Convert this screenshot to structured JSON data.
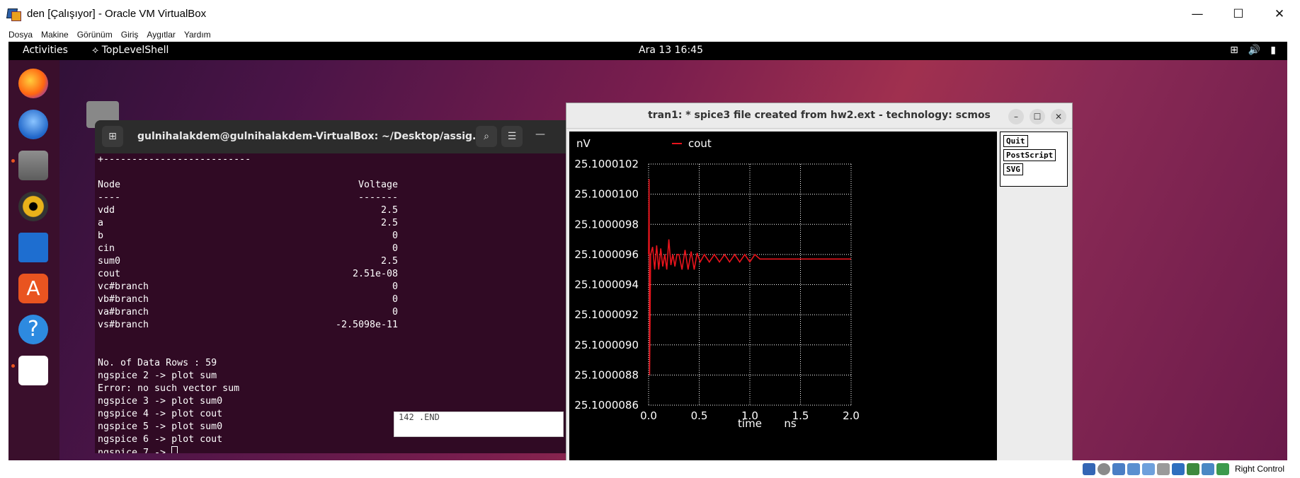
{
  "window": {
    "title": "den [Çalışıyor] - Oracle VM VirtualBox",
    "minimize_glyph": "—",
    "maximize_glyph": "☐",
    "close_glyph": "✕"
  },
  "menubar": {
    "items": [
      "Dosya",
      "Makine",
      "Görünüm",
      "Giriş",
      "Aygıtlar",
      "Yardım"
    ]
  },
  "topbar": {
    "activities": "Activities",
    "app_name": "TopLevelShell",
    "clock": "Ara 13  16:45"
  },
  "terminal": {
    "title": "gulnihalakdem@gulnihalakdem-VirtualBox: ~/Desktop/assig...",
    "lines": [
      {
        "left": "+--------------------------",
        "right": ""
      },
      {
        "left": "",
        "right": ""
      },
      {
        "left": "Node",
        "right": "Voltage"
      },
      {
        "left": "----",
        "right": "-------"
      },
      {
        "left": "vdd",
        "right": "2.5"
      },
      {
        "left": "a",
        "right": "2.5"
      },
      {
        "left": "b",
        "right": "0"
      },
      {
        "left": "cin",
        "right": "0"
      },
      {
        "left": "sum0",
        "right": "2.5"
      },
      {
        "left": "cout",
        "right": "2.51e-08"
      },
      {
        "left": "vc#branch",
        "right": "0"
      },
      {
        "left": "vb#branch",
        "right": "0"
      },
      {
        "left": "va#branch",
        "right": "0"
      },
      {
        "left": "vs#branch",
        "right": "-2.5098e-11"
      },
      {
        "left": "",
        "right": ""
      },
      {
        "left": "",
        "right": ""
      },
      {
        "left": "No. of Data Rows : 59",
        "right": ""
      },
      {
        "left": "ngspice 2 -> plot sum",
        "right": ""
      },
      {
        "left": "Error: no such vector sum",
        "right": ""
      },
      {
        "left": "ngspice 3 -> plot sum0",
        "right": ""
      },
      {
        "left": "ngspice 4 -> plot cout",
        "right": ""
      },
      {
        "left": "ngspice 5 -> plot sum0",
        "right": ""
      },
      {
        "left": "ngspice 6 -> plot cout",
        "right": ""
      }
    ],
    "prompt": "ngspice 7 -> "
  },
  "editor_strip": {
    "text": "142 .END"
  },
  "plot_window": {
    "title": "tran1: * spice3 file created from hw2.ext - technology: scmos",
    "buttons": {
      "quit": "Quit",
      "postscript": "PostScript",
      "svg": "SVG"
    }
  },
  "chart_data": {
    "type": "line",
    "title": "",
    "xlabel": "time",
    "xunit": "ns",
    "ylabel": "",
    "yunit": "nV",
    "xlim": [
      0.0,
      2.0
    ],
    "ylim": [
      25.1000086,
      25.1000102
    ],
    "xticks": [
      "0.0",
      "0.5",
      "1.0",
      "1.5",
      "2.0"
    ],
    "yticks": [
      "25.1000086",
      "25.1000088",
      "25.1000090",
      "25.1000092",
      "25.1000094",
      "25.1000096",
      "25.1000098",
      "25.1000100",
      "25.1000102"
    ],
    "grid": true,
    "legend_position": "top",
    "series": [
      {
        "name": "cout",
        "color": "#e8141c",
        "x": [
          0.0,
          0.005,
          0.01,
          0.02,
          0.04,
          0.06,
          0.08,
          0.1,
          0.12,
          0.14,
          0.16,
          0.18,
          0.2,
          0.22,
          0.24,
          0.26,
          0.28,
          0.3,
          0.33,
          0.36,
          0.39,
          0.42,
          0.45,
          0.48,
          0.51,
          0.55,
          0.6,
          0.65,
          0.7,
          0.75,
          0.8,
          0.85,
          0.9,
          0.95,
          1.0,
          1.05,
          1.1,
          1.2,
          1.4,
          1.6,
          1.8,
          2.0
        ],
        "y": [
          25.1000096,
          25.1000101,
          25.1000088,
          25.1000096,
          25.10000965,
          25.1000095,
          25.10000966,
          25.1000095,
          25.10000964,
          25.10000952,
          25.1000096,
          25.1000095,
          25.1000097,
          25.10000953,
          25.1000096,
          25.10000952,
          25.1000096,
          25.1000096,
          25.1000095,
          25.10000963,
          25.1000095,
          25.10000962,
          25.1000095,
          25.10000961,
          25.10000955,
          25.1000096,
          25.10000955,
          25.1000096,
          25.10000955,
          25.1000096,
          25.10000955,
          25.1000096,
          25.10000955,
          25.1000096,
          25.10000955,
          25.1000096,
          25.10000957,
          25.10000957,
          25.10000957,
          25.10000957,
          25.10000957,
          25.10000957
        ]
      }
    ]
  },
  "tray": {
    "label": "Right Control"
  },
  "colors": {
    "terminal_bg": "#300a24",
    "plot_bg": "#000000",
    "series": "#e8141c",
    "ubuntu_orange": "#e95420"
  }
}
